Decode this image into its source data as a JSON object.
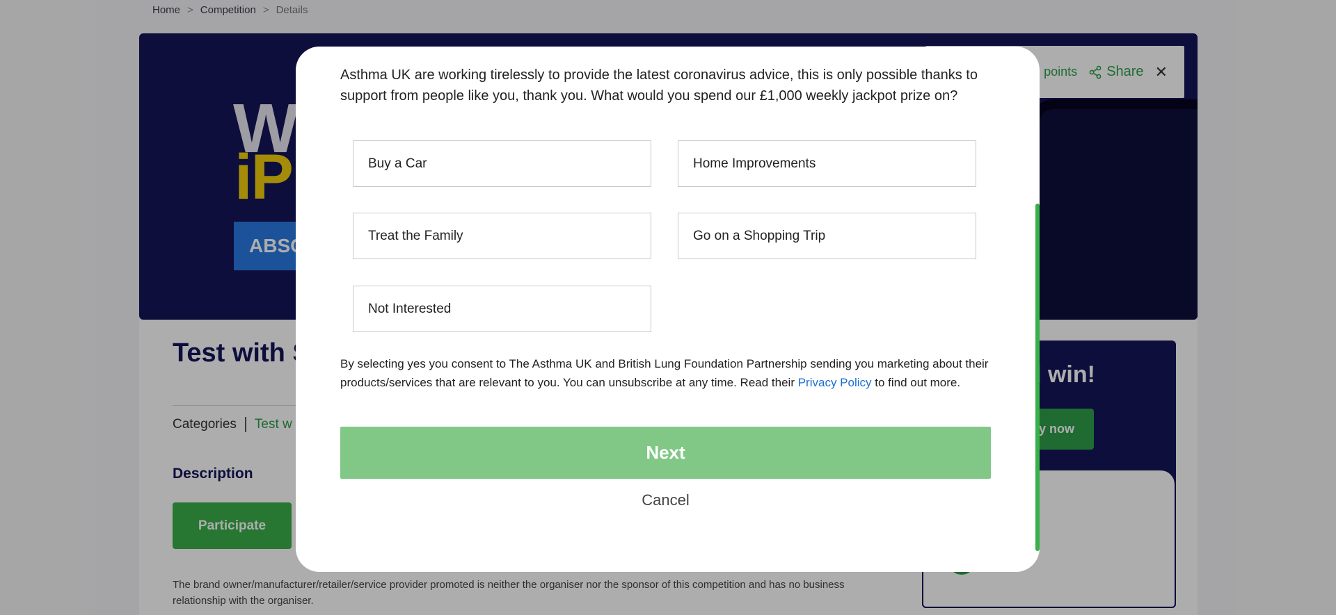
{
  "breadcrumb": {
    "home": "Home",
    "competition": "Competition",
    "current": "Details",
    "separator": ">"
  },
  "hero": {
    "w_text": "W",
    "ip_text": "iP",
    "abso_text": "ABSO"
  },
  "hero_actions": {
    "points": "points",
    "share": "Share",
    "close": "✕"
  },
  "page": {
    "title": "Test with S",
    "categories_label": "Categories",
    "categories_link": "Test w",
    "description_heading": "Description",
    "participate_label": "Participate",
    "disclaimer": "The brand owner/manufacturer/retailer/service provider promoted is neither the organiser nor the sponsor of this competition and has no business relationship with the organiser."
  },
  "side": {
    "heading": "nd win!",
    "play_label": "y now"
  },
  "modal": {
    "intro": "Asthma UK are working tirelessly to provide the latest coronavirus advice, this is only possible thanks to support from people like you, thank you. What would you spend our £1,000 weekly jackpot prize on?",
    "options": [
      "Buy a Car",
      "Home Improvements",
      "Treat the Family",
      "Go on a Shopping Trip",
      "Not Interested"
    ],
    "consent_before": "By selecting yes you consent to The Asthma UK and British Lung Foundation Partnership sending you marketing about their products/services that are relevant to you. You can unsubscribe at any time. Read their ",
    "privacy_link": "Privacy Policy",
    "consent_after": " to find out more.",
    "next_label": "Next",
    "cancel_label": "Cancel"
  },
  "colors": {
    "navy": "#141659",
    "green": "#2e9e4a",
    "next_green": "#81c887",
    "link_blue": "#1a6fd1"
  }
}
